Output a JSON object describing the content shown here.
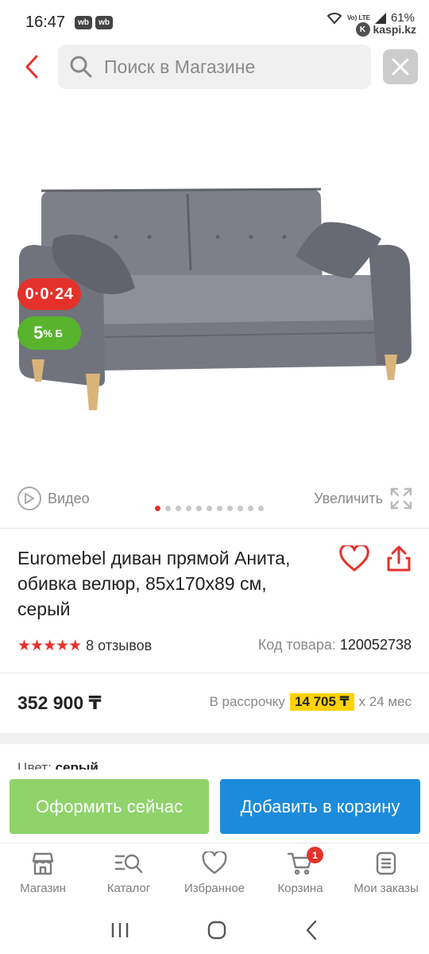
{
  "status_bar": {
    "time": "16:47",
    "notification_badges": [
      "wb",
      "wb"
    ],
    "network": "Vo) LTE",
    "battery": "61%",
    "watermark": "kaspi.kz"
  },
  "header": {
    "search_placeholder": "Поиск в Магазине"
  },
  "badges": {
    "installment": "0·0·24",
    "bonus_percent": "5",
    "bonus_unit": "% Б"
  },
  "media": {
    "video_label": "Видео",
    "zoom_label": "Увеличить",
    "slide_count": 11,
    "active_slide": 1
  },
  "product": {
    "title": "Euromebel диван прямой Анита, обивка велюр, 85x170x89 см, серый",
    "rating_stars": "★★★★★",
    "reviews": "8 отзывов",
    "sku_label": "Код товара:",
    "sku_value": "120052738",
    "price": "352 900 ₸",
    "installment_prefix": "В рассрочку",
    "installment_amount": "14 705 ₸",
    "installment_suffix": "х 24 мес",
    "color_label": "Цвет:",
    "color_value": "серый"
  },
  "actions": {
    "buy_now": "Оформить сейчас",
    "add_to_cart": "Добавить в корзину"
  },
  "bottom_nav": {
    "items": [
      {
        "label": "Магазин",
        "icon": "shop-icon"
      },
      {
        "label": "Каталог",
        "icon": "catalog-search-icon"
      },
      {
        "label": "Избранное",
        "icon": "heart-icon"
      },
      {
        "label": "Корзина",
        "icon": "cart-icon",
        "badge": "1"
      },
      {
        "label": "Мои заказы",
        "icon": "orders-icon"
      }
    ]
  },
  "colors": {
    "accent_red": "#e4322b",
    "bonus_green": "#58b42c",
    "buy_now_green": "#8fd36a",
    "cart_blue": "#1c8bdb",
    "installment_yellow": "#ffd200"
  }
}
